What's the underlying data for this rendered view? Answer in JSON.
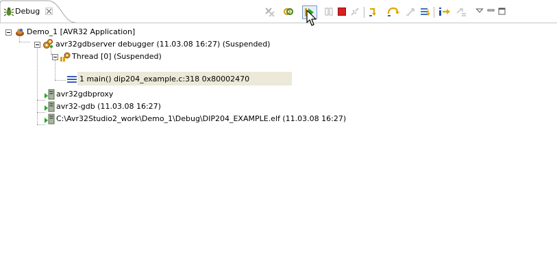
{
  "tab": {
    "label": "Debug",
    "icon": "debug-bug-icon",
    "close_icon": "close-icon"
  },
  "toolbar": {
    "buttons": [
      {
        "name": "remove-all-terminated-button",
        "icon": "remove-terminated-icon",
        "enabled": false
      },
      {
        "name": "connect-button",
        "icon": "connect-icon",
        "enabled": true
      },
      {
        "name": "resume-button",
        "icon": "resume-icon",
        "enabled": true,
        "pressed": true
      },
      {
        "name": "suspend-button",
        "icon": "suspend-icon",
        "enabled": false
      },
      {
        "name": "terminate-button",
        "icon": "terminate-icon",
        "enabled": true
      },
      {
        "name": "disconnect-button",
        "icon": "disconnect-icon",
        "enabled": false
      },
      {
        "name": "step-into-button",
        "icon": "step-into-icon",
        "enabled": true
      },
      {
        "name": "step-over-button",
        "icon": "step-over-icon",
        "enabled": true
      },
      {
        "name": "step-return-button",
        "icon": "step-return-icon",
        "enabled": false
      },
      {
        "name": "drop-to-frame-button",
        "icon": "drop-to-frame-icon",
        "enabled": true
      },
      {
        "name": "instruction-stepping-button",
        "icon": "instruction-step-icon",
        "enabled": true
      },
      {
        "name": "use-step-filters-button",
        "icon": "step-filters-icon",
        "enabled": false
      },
      {
        "name": "view-menu-button",
        "icon": "view-menu-icon",
        "enabled": true
      },
      {
        "name": "minimize-button",
        "icon": "minimize-icon",
        "enabled": true
      },
      {
        "name": "maximize-button",
        "icon": "maximize-icon",
        "enabled": true
      }
    ]
  },
  "tree": {
    "launch": {
      "label": "Demo_1 [AVR32 Application]",
      "icon": "launch-icon",
      "expanded": true
    },
    "debugger": {
      "label": "avr32gdbserver debugger (11.03.08 16:27) (Suspended)",
      "icon": "debug-target-icon",
      "expanded": true
    },
    "thread": {
      "label": "Thread [0] (Suspended)",
      "icon": "thread-suspended-icon",
      "expanded": true
    },
    "frame": {
      "label": "1 main() dip204_example.c:318 0x80002470",
      "icon": "stack-frame-icon",
      "selected": true
    },
    "processes": [
      {
        "label": "avr32gdbproxy",
        "icon": "process-icon"
      },
      {
        "label": "avr32-gdb (11.03.08 16:27)",
        "icon": "process-icon"
      },
      {
        "label": "C:\\Avr32Studio2_work\\Demo_1\\Debug\\DIP204_EXAMPLE.elf (11.03.08 16:27)",
        "icon": "process-icon"
      }
    ]
  },
  "colors": {
    "selection": "#ece9d8",
    "tab_border": "#a4a4a4",
    "terminate_red": "#d82020",
    "resume_green": "#2aa52a",
    "step_yellow": "#e0a800"
  }
}
